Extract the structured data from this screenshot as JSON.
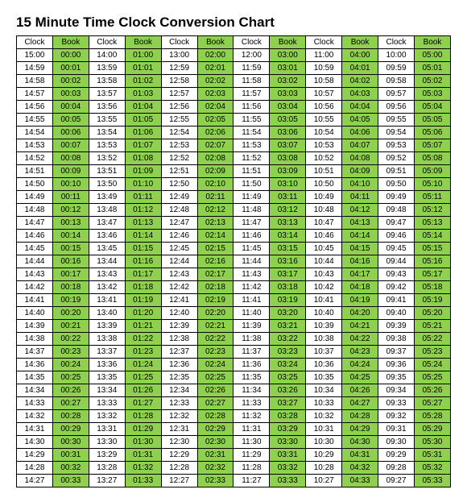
{
  "title": "15 Minute Time Clock Conversion Chart",
  "header_clock": "Clock",
  "header_book": "Book",
  "columns": [
    {
      "clock_start": "15:00",
      "book_start": "00:00"
    },
    {
      "clock_start": "14:00",
      "book_start": "01:00"
    },
    {
      "clock_start": "13:00",
      "book_start": "02:00"
    },
    {
      "clock_start": "12:00",
      "book_start": "03:00"
    },
    {
      "clock_start": "11:00",
      "book_start": "04:00"
    },
    {
      "clock_start": "10:00",
      "book_start": "05:00"
    }
  ],
  "row_count": 34
}
